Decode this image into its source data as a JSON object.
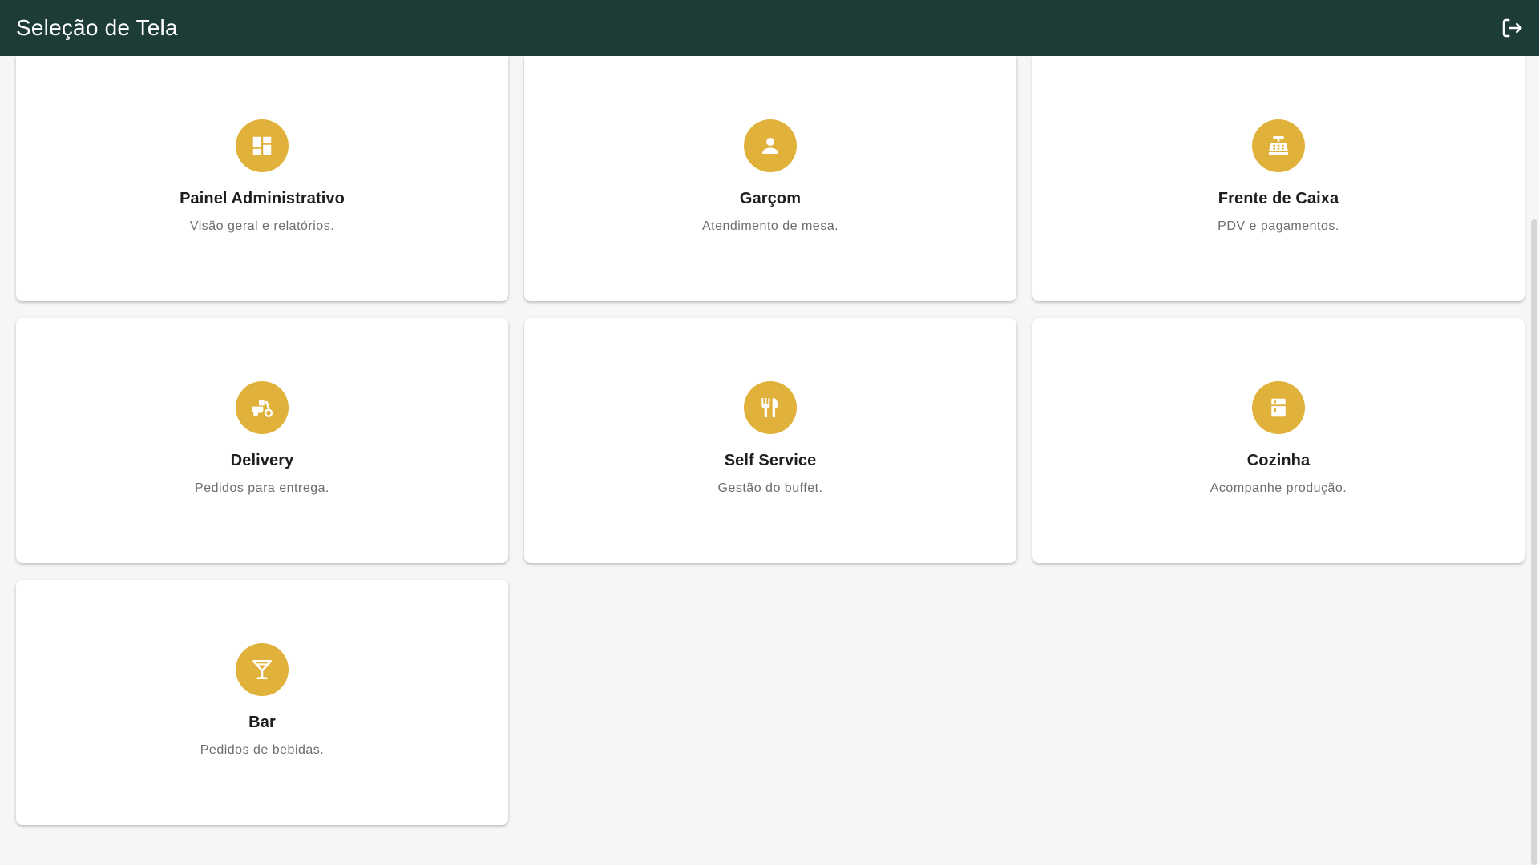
{
  "appbar": {
    "title": "Seleção de Tela",
    "logout_icon": "logout-icon"
  },
  "colors": {
    "appbar_bg": "#1d3c37",
    "icon_circle": "#e0b13b",
    "page_bg": "#f6f6f6"
  },
  "cards": [
    {
      "id": "painel-administrativo",
      "icon": "dashboard-icon",
      "title": "Painel Administrativo",
      "description": "Visão geral e relatórios."
    },
    {
      "id": "garcom",
      "icon": "person-icon",
      "title": "Garçom",
      "description": "Atendimento de mesa."
    },
    {
      "id": "frente-de-caixa",
      "icon": "cash-register-icon",
      "title": "Frente de Caixa",
      "description": "PDV e pagamentos."
    },
    {
      "id": "delivery",
      "icon": "delivery-scooter-icon",
      "title": "Delivery",
      "description": "Pedidos para entrega."
    },
    {
      "id": "self-service",
      "icon": "utensils-icon",
      "title": "Self Service",
      "description": "Gestão do buffet."
    },
    {
      "id": "cozinha",
      "icon": "kitchen-icon",
      "title": "Cozinha",
      "description": "Acompanhe produção."
    },
    {
      "id": "bar",
      "icon": "cocktail-icon",
      "title": "Bar",
      "description": "Pedidos de bebidas."
    }
  ]
}
